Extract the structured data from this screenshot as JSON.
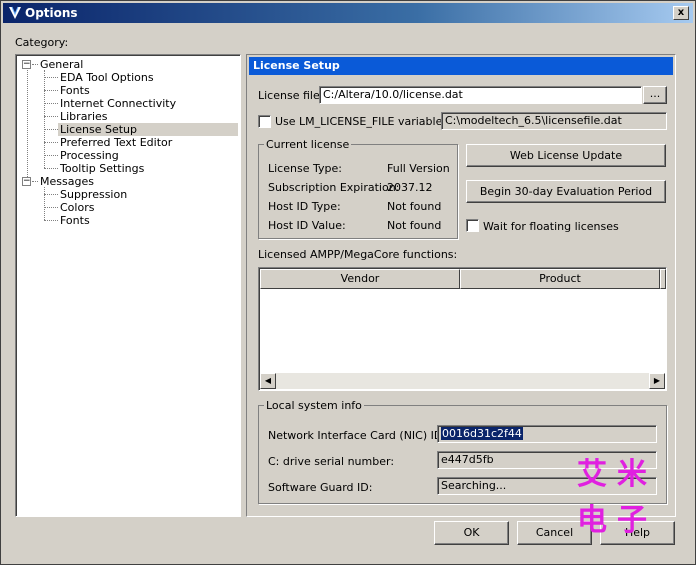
{
  "window": {
    "title": "Options",
    "close_label": "x"
  },
  "category_label": "Category:",
  "tree": [
    {
      "label": "General",
      "level": 0,
      "expander": "−"
    },
    {
      "label": "EDA Tool Options",
      "level": 1
    },
    {
      "label": "Fonts",
      "level": 1
    },
    {
      "label": "Internet Connectivity",
      "level": 1
    },
    {
      "label": "Libraries",
      "level": 1
    },
    {
      "label": "License Setup",
      "level": 1,
      "selected": true
    },
    {
      "label": "Preferred Text Editor",
      "level": 1
    },
    {
      "label": "Processing",
      "level": 1
    },
    {
      "label": "Tooltip Settings",
      "level": 1
    },
    {
      "label": "Messages",
      "level": 0,
      "expander": "−"
    },
    {
      "label": "Suppression",
      "level": 1
    },
    {
      "label": "Colors",
      "level": 1
    },
    {
      "label": "Fonts",
      "level": 1
    }
  ],
  "panel": {
    "header": "License Setup",
    "license_file_label": "License file:",
    "license_file_value": "C:/Altera/10.0/license.dat",
    "browse_label": "...",
    "use_lm_label": "Use LM_LICENSE_FILE variable:",
    "lm_value": "C:\\modeltech_6.5\\licensefile.dat",
    "current_license": {
      "title": "Current license",
      "rows": [
        {
          "label": "License Type:",
          "value": "Full Version"
        },
        {
          "label": "Subscription Expiration:",
          "value": "2037.12"
        },
        {
          "label": "Host ID Type:",
          "value": "Not found"
        },
        {
          "label": "Host ID Value:",
          "value": "Not found"
        }
      ]
    },
    "web_license_update": "Web License Update",
    "eval_period": "Begin 30-day Evaluation Period",
    "wait_floating": "Wait for floating licenses",
    "ampp_label": "Licensed AMPP/MegaCore functions:",
    "columns": [
      "Vendor",
      "Product"
    ],
    "local_system": {
      "title": "Local system info",
      "nic_label": "Network Interface Card (NIC) ID:",
      "nic_value": "0016d31c2f44",
      "serial_label": "C: drive serial number:",
      "serial_value": "e447d5fb",
      "guard_label": "Software Guard ID:",
      "guard_value": "Searching..."
    }
  },
  "buttons": {
    "ok": "OK",
    "cancel": "Cancel",
    "help": "Help"
  },
  "watermark": {
    "top": "艾米",
    "bottom": "电子"
  }
}
